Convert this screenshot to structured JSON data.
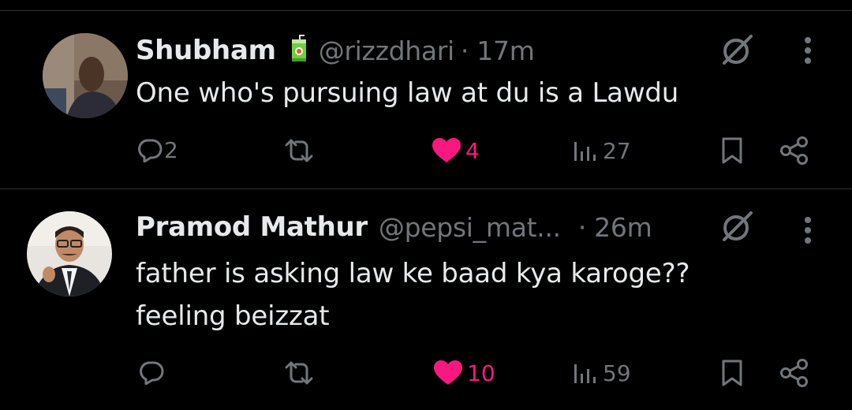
{
  "tweets": [
    {
      "display_name": "Shubham",
      "handle": "@rizzdhari",
      "time": "· 17m",
      "text_lines": [
        "One who's pursuing law at du is a Lawdu"
      ],
      "replies": "2",
      "likes": "4",
      "views": "27",
      "liked": true,
      "badge_icon": "juice-box-icon"
    },
    {
      "display_name": "Pramod Mathur",
      "handle": "@pepsi_mat...",
      "time": "· 26m",
      "text_lines": [
        "father is asking law ke baad kya karoge??",
        "feeling beizzat"
      ],
      "replies": "",
      "likes": "10",
      "views": "59",
      "liked": true
    }
  ],
  "colors": {
    "background": "#000000",
    "text": "#e7e9ea",
    "muted": "#71767b",
    "like": "#f91880",
    "divider": "#2f3336"
  }
}
